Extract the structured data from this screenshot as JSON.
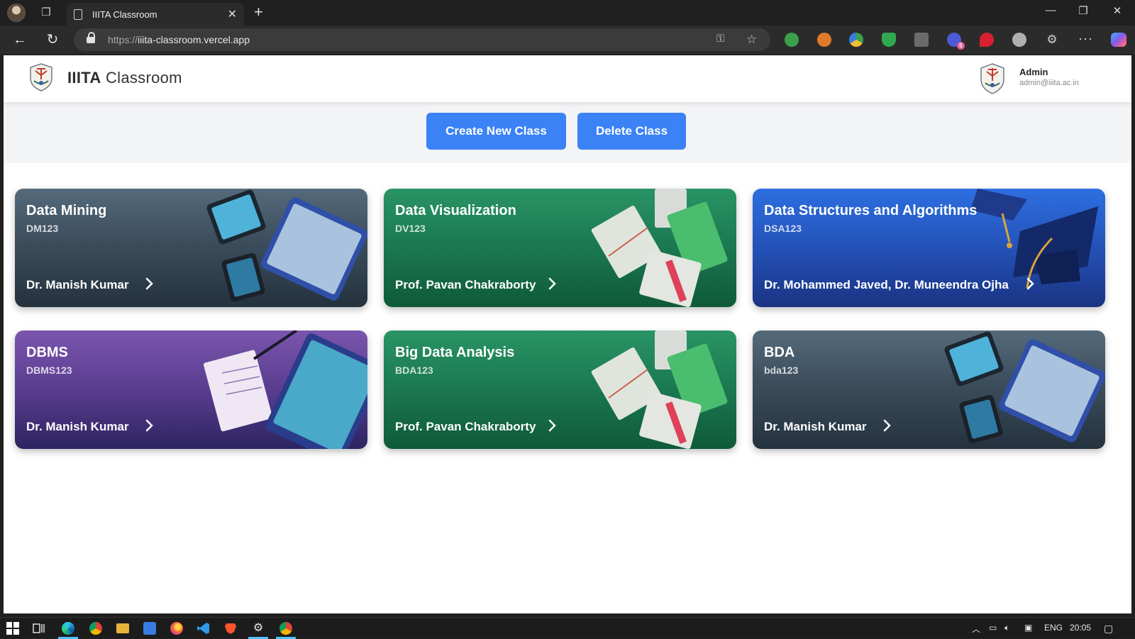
{
  "browser": {
    "tab_title": "IIITA Classroom",
    "url_protocol": "https://",
    "url_host": "iiita-classroom.vercel.app",
    "extension_badge": "5"
  },
  "header": {
    "brand_bold": "IIITA",
    "brand_light": "Classroom",
    "user_name": "Admin",
    "user_email": "admin@iiita.ac.in"
  },
  "actions": {
    "create_label": "Create New Class",
    "delete_label": "Delete Class"
  },
  "classes": [
    {
      "title": "Data Mining",
      "code": "DM123",
      "teacher": "Dr. Manish Kumar",
      "theme": "slate"
    },
    {
      "title": "Data Visualization",
      "code": "DV123",
      "teacher": "Prof. Pavan Chakraborty",
      "theme": "green"
    },
    {
      "title": "Data Structures and Algorithms",
      "code": "DSA123",
      "teacher": "Dr. Mohammed Javed, Dr. Muneendra Ojha",
      "theme": "blue"
    },
    {
      "title": "DBMS",
      "code": "DBMS123",
      "teacher": "Dr. Manish Kumar",
      "theme": "purple"
    },
    {
      "title": "Big Data Analysis",
      "code": "BDA123",
      "teacher": "Prof. Pavan Chakraborty",
      "theme": "green"
    },
    {
      "title": "BDA",
      "code": "bda123",
      "teacher": "Dr. Manish Kumar",
      "theme": "slate"
    }
  ],
  "taskbar": {
    "language": "ENG",
    "time": "20:05"
  },
  "colors": {
    "primary_button": "#3b82f6",
    "card_slate": "#3c4d5c",
    "card_green": "#1c7a52",
    "card_blue": "#2452b8",
    "card_purple": "#5a3d8f"
  }
}
